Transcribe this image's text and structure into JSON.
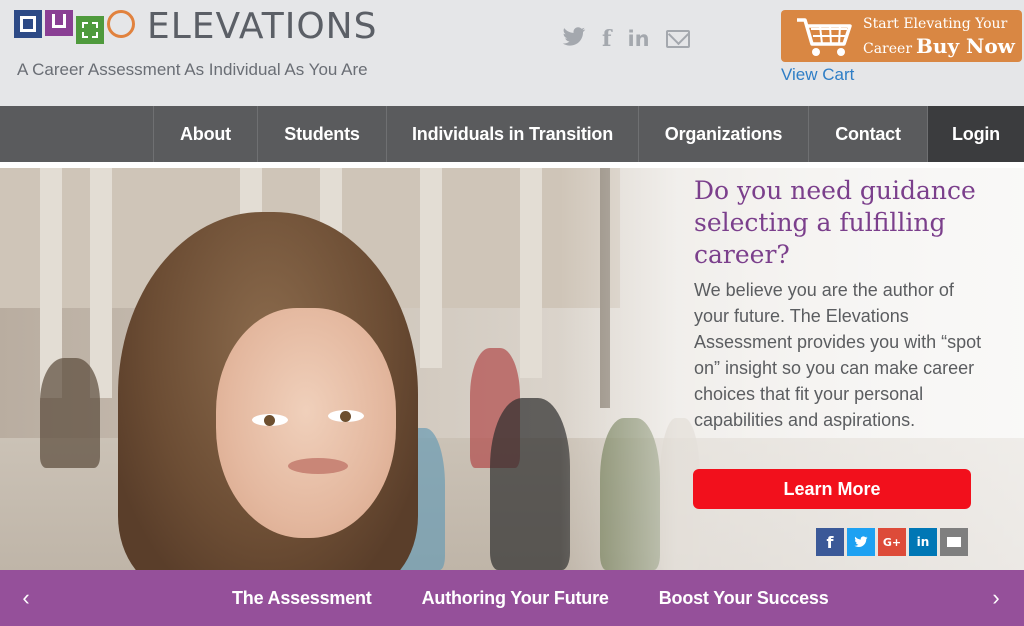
{
  "header": {
    "brand": "ELEVATIONS",
    "tagline": "A Career Assessment As Individual As You Are",
    "social_icons": [
      "twitter-icon",
      "facebook-icon",
      "linkedin-icon",
      "mail-icon"
    ],
    "buy": {
      "line1": "Start Elevating Your",
      "line2_prefix": "Career",
      "line2_strong": "Buy Now"
    },
    "view_cart": "View Cart"
  },
  "nav": {
    "items": [
      {
        "label": "About"
      },
      {
        "label": "Students"
      },
      {
        "label": "Individuals in Transition"
      },
      {
        "label": "Organizations"
      },
      {
        "label": "Contact"
      },
      {
        "label": "Login"
      }
    ]
  },
  "hero": {
    "title": "Do you need guidance selecting a fulfilling career?",
    "body": "We believe you are the author of your future. The Elevations Assessment provides you with “spot on” insight so you can make career choices that fit your personal capabilities and aspirations.",
    "cta": "Learn More",
    "share": [
      "f",
      "t",
      "G+",
      "in",
      "mail"
    ]
  },
  "bottom_bar": {
    "prev": "‹",
    "next": "›",
    "links": [
      "The Assessment",
      "Authoring Your Future",
      "Boost Your Success"
    ]
  },
  "colors": {
    "header_bg": "#e5e6e8",
    "nav_bg": "#5a5b5d",
    "accent_purple": "#95509a",
    "title_purple": "#7b3f8c",
    "cta_red": "#f2101c",
    "buy_orange": "#d98743",
    "link_blue": "#2f7ec6"
  }
}
